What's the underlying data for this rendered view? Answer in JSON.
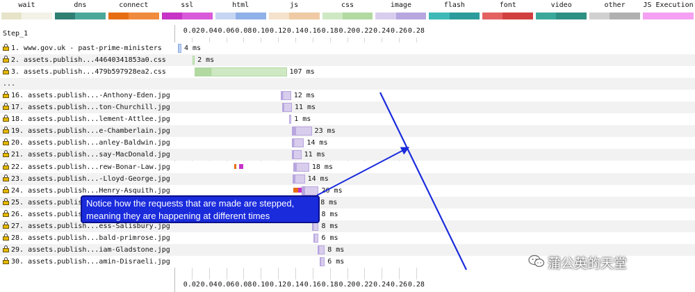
{
  "legend": [
    {
      "label": "wait",
      "colors": [
        "#e6e3c8",
        "#f4f2e6"
      ]
    },
    {
      "label": "dns",
      "colors": [
        "#2f7f73",
        "#4aa89a"
      ]
    },
    {
      "label": "connect",
      "colors": [
        "#e66d12",
        "#f08a3c"
      ]
    },
    {
      "label": "ssl",
      "colors": [
        "#c633c6",
        "#d95ad9"
      ]
    },
    {
      "label": "html",
      "colors": [
        "#c6d6f2",
        "#8fb0e8"
      ]
    },
    {
      "label": "js",
      "colors": [
        "#f5e2cc",
        "#efcaa4"
      ]
    },
    {
      "label": "css",
      "colors": [
        "#cfe8c4",
        "#b1d9a1"
      ]
    },
    {
      "label": "image",
      "colors": [
        "#d8cdec",
        "#b8a6df"
      ]
    },
    {
      "label": "flash",
      "colors": [
        "#3fb8b8",
        "#2c9b9b"
      ]
    },
    {
      "label": "font",
      "colors": [
        "#e36161",
        "#d23f3f"
      ]
    },
    {
      "label": "video",
      "colors": [
        "#3aa89a",
        "#2e8f83"
      ]
    },
    {
      "label": "other",
      "colors": [
        "#d0d0d0",
        "#b0b0b0"
      ]
    },
    {
      "label": "JS Execution",
      "colors": [
        "#f5a0f2",
        "#f5a0f2"
      ]
    }
  ],
  "waterfall": {
    "step_label": "Step_1",
    "ellipsis": "...",
    "ticks": [
      "0.02",
      "0.04",
      "0.06",
      "0.08",
      "0.10",
      "0.12",
      "0.14",
      "0.16",
      "0.18",
      "0.20",
      "0.22",
      "0.24",
      "0.26",
      "0.28"
    ],
    "rows": [
      {
        "label": "1. www.gov.uk - past-prime-ministers",
        "start": 0.004,
        "dur": 0.004,
        "type": "html",
        "time": "4 ms"
      },
      {
        "label": "2. assets.publish...44640341853a0.css",
        "start": 0.021,
        "dur": 0.002,
        "type": "css",
        "time": "2 ms"
      },
      {
        "label": "3. assets.publish...479b597928ea2.css",
        "start": 0.023,
        "dur": 0.107,
        "type": "css",
        "time": "107 ms"
      },
      {
        "label": "...",
        "ellipsis": true
      },
      {
        "label": "16. assets.publish...-Anthony-Eden.jpg",
        "start": 0.123,
        "dur": 0.012,
        "type": "image",
        "time": "12 ms"
      },
      {
        "label": "17. assets.publish...ton-Churchill.jpg",
        "start": 0.125,
        "dur": 0.011,
        "type": "image",
        "time": "11 ms"
      },
      {
        "label": "18. assets.publish...lement-Attlee.jpg",
        "start": 0.133,
        "dur": 0.001,
        "type": "image",
        "time": "1 ms"
      },
      {
        "label": "19. assets.publish...e-Chamberlain.jpg",
        "start": 0.136,
        "dur": 0.023,
        "type": "image",
        "time": "23 ms"
      },
      {
        "label": "20. assets.publish...anley-Baldwin.jpg",
        "start": 0.136,
        "dur": 0.014,
        "type": "image",
        "time": "14 ms"
      },
      {
        "label": "21. assets.publish...say-MacDonald.jpg",
        "start": 0.136,
        "dur": 0.011,
        "type": "image",
        "time": "11 ms"
      },
      {
        "label": "22. assets.publish...rew-Bonar-Law.jpg",
        "start": 0.138,
        "dur": 0.018,
        "type": "image",
        "time": "18 ms",
        "extras": [
          {
            "at": 0.069,
            "color": "#e66d12",
            "w": 3
          },
          {
            "at": 0.075,
            "color": "#c633c6",
            "w": 6
          }
        ]
      },
      {
        "label": "23. assets.publish...-Lloyd-George.jpg",
        "start": 0.137,
        "dur": 0.014,
        "type": "image",
        "time": "14 ms"
      },
      {
        "label": "24. assets.publish...Henry-Asquith.jpg",
        "start": 0.147,
        "dur": 0.02,
        "type": "image",
        "time": "20 ms",
        "extras": [
          {
            "at": 0.138,
            "color": "#e66d12",
            "w": 12
          },
          {
            "at": 0.143,
            "color": "#c633c6",
            "w": 8
          }
        ]
      },
      {
        "label": "25. assets.publish...",
        "start": 0.158,
        "dur": 0.008,
        "type": "image",
        "time": "8 ms"
      },
      {
        "label": "26. assets.publish...",
        "start": 0.159,
        "dur": 0.008,
        "type": "image",
        "time": "8 ms"
      },
      {
        "label": "27. assets.publish...ess-Salisbury.jpg",
        "start": 0.159,
        "dur": 0.008,
        "type": "image",
        "time": "8 ms"
      },
      {
        "label": "28. assets.publish...bald-primrose.jpg",
        "start": 0.161,
        "dur": 0.006,
        "type": "image",
        "time": "6 ms"
      },
      {
        "label": "29. assets.publish...iam-Gladstone.jpg",
        "start": 0.166,
        "dur": 0.008,
        "type": "image",
        "time": "8 ms"
      },
      {
        "label": "30. assets.publish...amin-Disraeli.jpg",
        "start": 0.168,
        "dur": 0.006,
        "type": "image",
        "time": "6 ms"
      }
    ]
  },
  "annotation": {
    "line1": "Notice how the requests that are made are stepped,",
    "line2": "meaning they are happening at different times"
  },
  "watermark": "蒲公英的天堂"
}
